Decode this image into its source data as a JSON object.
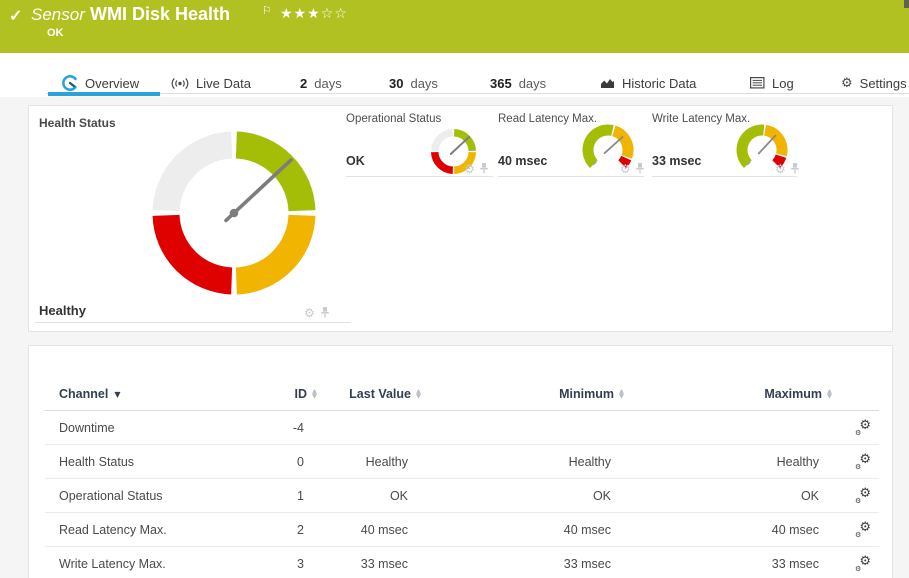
{
  "colors": {
    "header_bg": "#b2c122",
    "accent": "#2ba3d9",
    "ok": "#a4be07",
    "warn": "#f1b400",
    "error": "#df0000",
    "empty": "#ededed",
    "needle": "#7d7d7d"
  },
  "header": {
    "check_icon": "✓",
    "kind_label": "Sensor",
    "title": "WMI Disk Health",
    "flag_icon": "⚐",
    "stars": "★★★☆☆",
    "status": "OK"
  },
  "tabs": {
    "overview": {
      "label": "Overview"
    },
    "live_data": {
      "label": "Live Data"
    },
    "days2": {
      "num": "2",
      "unit": "days"
    },
    "days30": {
      "num": "30",
      "unit": "days"
    },
    "days365": {
      "num": "365",
      "unit": "days"
    },
    "historic": {
      "label": "Historic Data"
    },
    "log": {
      "label": "Log"
    },
    "settings": {
      "label": "Settings",
      "gear_icon": "⚙"
    }
  },
  "gauges": {
    "health": {
      "title": "Health Status",
      "value": "Healthy"
    },
    "operational": {
      "title": "Operational Status",
      "value": "OK"
    },
    "read_latency": {
      "title": "Read Latency Max.",
      "value": "40 msec"
    },
    "write_latency": {
      "title": "Write Latency Max.",
      "value": "33 msec"
    },
    "toolbar_gear_icon": "⚙"
  },
  "table": {
    "headers": {
      "channel": "Channel",
      "id": "ID",
      "last_value": "Last Value",
      "minimum": "Minimum",
      "maximum": "Maximum"
    },
    "sort_icons": {
      "desc": "▼",
      "up": "▲",
      "down": "▼"
    },
    "row_gear_icon": "⚙",
    "rows": [
      {
        "channel": "Downtime",
        "id": "-4",
        "last": "",
        "min": "",
        "max": ""
      },
      {
        "channel": "Health Status",
        "id": "0",
        "last": "Healthy",
        "min": "Healthy",
        "max": "Healthy"
      },
      {
        "channel": "Operational Status",
        "id": "1",
        "last": "OK",
        "min": "OK",
        "max": "OK"
      },
      {
        "channel": "Read Latency Max.",
        "id": "2",
        "last": "40 msec",
        "min": "40 msec",
        "max": "40 msec"
      },
      {
        "channel": "Write Latency Max.",
        "id": "3",
        "last": "33 msec",
        "min": "33 msec",
        "max": "33 msec"
      }
    ]
  }
}
